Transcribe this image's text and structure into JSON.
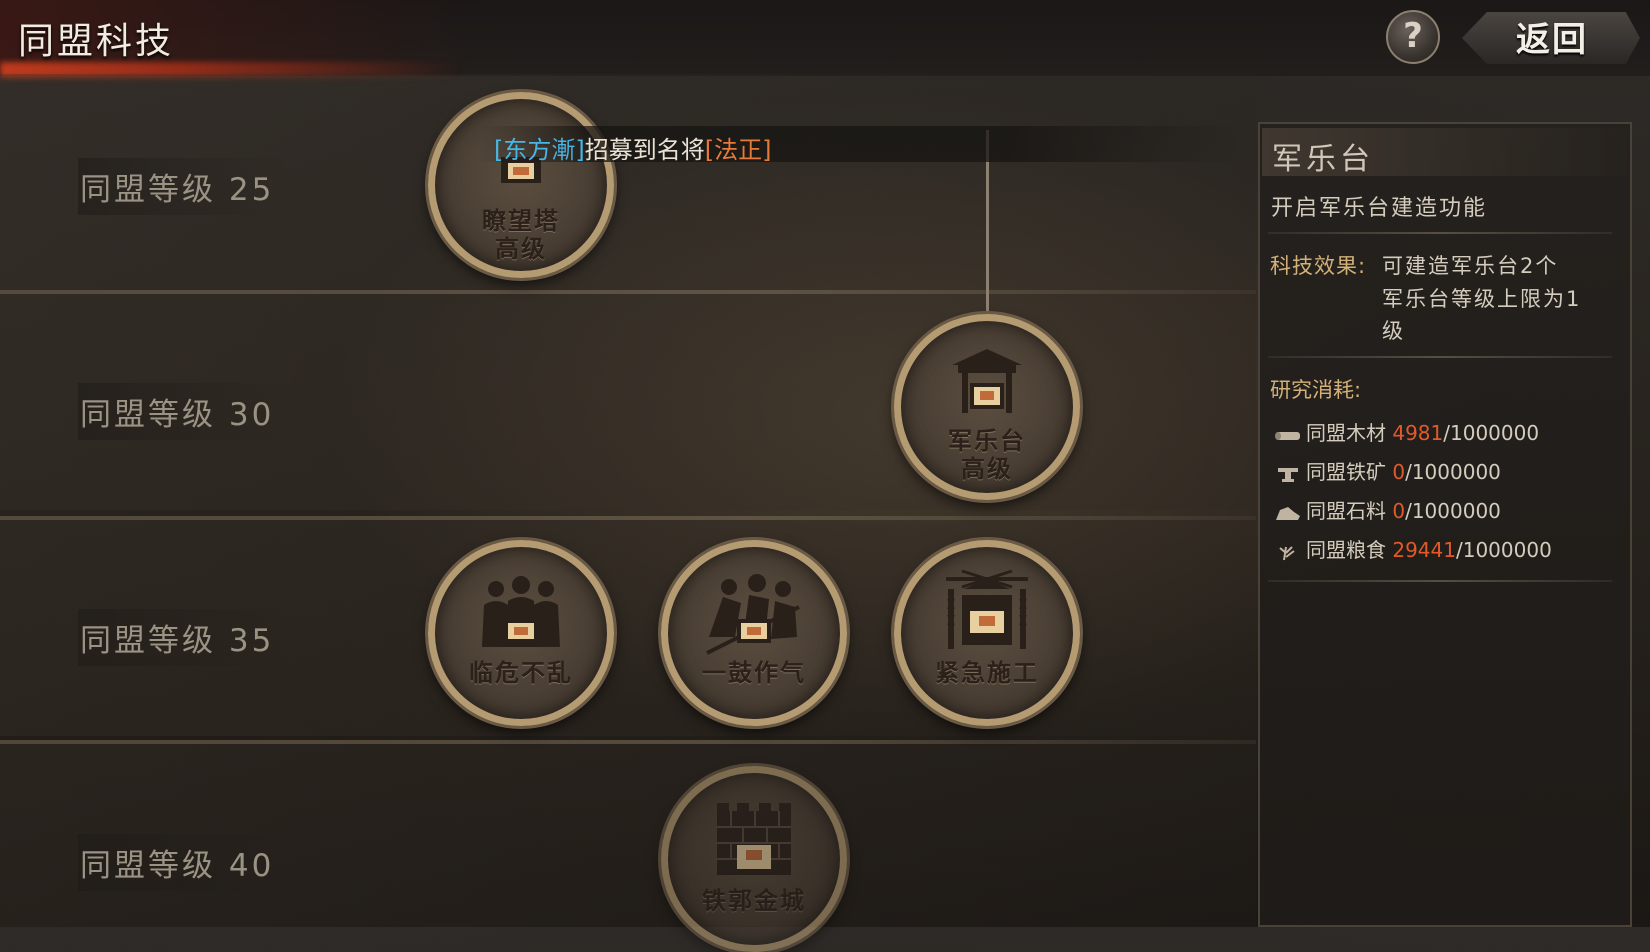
{
  "header": {
    "title": "同盟科技",
    "help_label": "?",
    "back_label": "返回"
  },
  "notice": {
    "player": "[东方漸]",
    "middle": "招募到名将",
    "general": "[法正]"
  },
  "levels": [
    {
      "label": "同盟等级 25"
    },
    {
      "label": "同盟等级 30"
    },
    {
      "label": "同盟等级 35"
    },
    {
      "label": "同盟等级 40"
    }
  ],
  "nodes": {
    "watchtower": {
      "line1": "瞭望塔",
      "line2": "高级"
    },
    "music_stage": {
      "line1": "军乐台",
      "line2": "高级"
    },
    "calm": {
      "line1": "临危不乱"
    },
    "drum": {
      "line1": "一鼓作气"
    },
    "urgent": {
      "line1": "紧急施工"
    },
    "fortress": {
      "line1": "铁郭金城"
    }
  },
  "panel": {
    "title": "军乐台",
    "description": "开启军乐台建造功能",
    "effect_label": "科技效果:",
    "effect_lines": [
      "可建造军乐台2个",
      "军乐台等级上限为1",
      "级"
    ],
    "cost_label": "研究消耗:",
    "costs": [
      {
        "icon": "wood-icon",
        "name": "同盟木材",
        "current": "4981",
        "total": "/1000000"
      },
      {
        "icon": "iron-ore-icon",
        "name": "同盟铁矿",
        "current": "0",
        "total": "/1000000"
      },
      {
        "icon": "stone-icon",
        "name": "同盟石料",
        "current": "0",
        "total": "/1000000"
      },
      {
        "icon": "grain-icon",
        "name": "同盟粮食",
        "current": "29441",
        "total": "/1000000"
      }
    ]
  },
  "colors": {
    "accent_gold": "#d2b078",
    "cost_current": "#e15a2a",
    "notice_player": "#47b6e6",
    "notice_general": "#e57a3b"
  }
}
